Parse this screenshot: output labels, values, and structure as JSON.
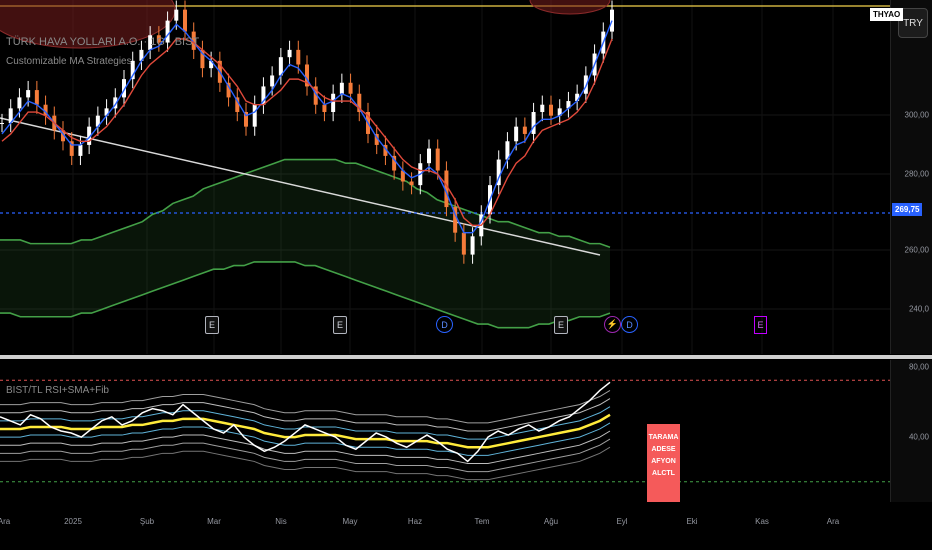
{
  "symbol_title": "TÜRK HAVA YOLLARI A.O. · 1G · BIST",
  "strategy_name": "Customizable MA Strategies",
  "indicator_name": "BIST/TL RSI+SMA+Fib",
  "symbol_tag": "THYAO",
  "currency_button": "TRY",
  "price_label": "269,75",
  "price_axis": [
    "300,00",
    "280,00",
    "260,00",
    "240,0"
  ],
  "indicator_axis": [
    "80,00",
    "40,00"
  ],
  "time_axis": [
    "Ara",
    "2025",
    "Şub",
    "Mar",
    "Nis",
    "May",
    "Haz",
    "Tem",
    "Ağu",
    "Eyl",
    "Eki",
    "Kas",
    "Ara"
  ],
  "events": [
    {
      "type": "E",
      "label": "E"
    },
    {
      "type": "E",
      "label": "E"
    },
    {
      "type": "D",
      "label": "D"
    },
    {
      "type": "E",
      "label": "E"
    },
    {
      "type": "S",
      "label": "⚡"
    },
    {
      "type": "D",
      "label": "D"
    },
    {
      "type": "P",
      "label": "E"
    }
  ],
  "scan_label": [
    "TARAMA",
    "ADESE",
    "AFYON",
    "ALCTL"
  ],
  "colors": {
    "background": "#000000",
    "up_candle": "#ffffff",
    "down_candle": "#f57c3a",
    "ma_fast": "#2962ff",
    "ma_slow": "#e0493a",
    "band": "#43a047",
    "trendline": "#d9d9d9",
    "resistance": "#f2d14b",
    "price_line": "#2962ff",
    "rsi": "#ffffff",
    "rsi_sma": "#ffeb3b",
    "scan_label": "#f55a5a"
  },
  "chart_data": {
    "type": "line",
    "title": "TÜRK HAVA YOLLARI A.O. · 1G · BIST",
    "last_price": 269.75,
    "ylim": [
      232,
      325
    ],
    "months": [
      "Ara",
      "2025",
      "Şub",
      "Mar",
      "Nis",
      "May",
      "Haz",
      "Tem",
      "Ağu",
      "Eyl",
      "Eki",
      "Kas",
      "Ara"
    ],
    "close": [
      293,
      297,
      300,
      302,
      298,
      295,
      291,
      288,
      284,
      287,
      292,
      295,
      297,
      300,
      305,
      310,
      313,
      317,
      315,
      321,
      324,
      318,
      313,
      308,
      310,
      304,
      300,
      296,
      292,
      298,
      303,
      306,
      311,
      313,
      309,
      303,
      298,
      296,
      301,
      304,
      301,
      296,
      290,
      287,
      284,
      280,
      277,
      276,
      282,
      286,
      280,
      270,
      263,
      257,
      262,
      268,
      276,
      283,
      288,
      292,
      290,
      296,
      298,
      295,
      297,
      299,
      301,
      306,
      312,
      318,
      324
    ],
    "ma_fast": [
      290,
      293,
      296,
      299,
      298,
      296,
      293,
      290,
      287,
      287,
      289,
      292,
      295,
      298,
      302,
      306,
      310,
      313,
      314,
      317,
      320,
      318,
      315,
      312,
      310,
      307,
      303,
      299,
      295,
      296,
      299,
      302,
      306,
      309,
      308,
      305,
      301,
      298,
      299,
      301,
      300,
      297,
      293,
      289,
      286,
      283,
      280,
      278,
      279,
      281,
      279,
      274,
      268,
      263,
      263,
      266,
      272,
      278,
      283,
      287,
      288,
      292,
      294,
      294,
      295,
      297,
      299,
      303,
      309,
      315,
      321
    ],
    "ma_slow": [
      288,
      290,
      293,
      296,
      296,
      295,
      293,
      291,
      289,
      288,
      288,
      290,
      292,
      295,
      298,
      302,
      306,
      309,
      311,
      313,
      316,
      316,
      315,
      313,
      311,
      309,
      306,
      303,
      299,
      298,
      298,
      300,
      302,
      305,
      305,
      304,
      302,
      300,
      299,
      299,
      299,
      297,
      295,
      292,
      289,
      286,
      283,
      281,
      280,
      280,
      279,
      276,
      272,
      267,
      265,
      265,
      268,
      273,
      278,
      282,
      284,
      288,
      291,
      292,
      293,
      294,
      296,
      299,
      304,
      310,
      316
    ],
    "band_upper": [
      261,
      261,
      261,
      260,
      260,
      260,
      260,
      260,
      261,
      261,
      262,
      263,
      264,
      265,
      266,
      268,
      269,
      271,
      272,
      273,
      275,
      276,
      277,
      278,
      279,
      280,
      281,
      282,
      283,
      283,
      283,
      283,
      283,
      283,
      282,
      282,
      281,
      280,
      279,
      278,
      277,
      275,
      274,
      272,
      271,
      270,
      269,
      268,
      267,
      266,
      266,
      265,
      264,
      263,
      263,
      262,
      262,
      261,
      260,
      260,
      259
    ],
    "band_lower": [
      241,
      241,
      240,
      240,
      240,
      240,
      240,
      240,
      241,
      241,
      242,
      243,
      244,
      245,
      246,
      247,
      248,
      249,
      250,
      251,
      252,
      253,
      253,
      254,
      254,
      255,
      255,
      255,
      255,
      255,
      254,
      254,
      253,
      252,
      251,
      250,
      249,
      248,
      247,
      246,
      245,
      244,
      243,
      242,
      241,
      240,
      239,
      238,
      238,
      237,
      237,
      237,
      237,
      238,
      238,
      239,
      239,
      240,
      240,
      240,
      241
    ],
    "rsi": [
      62,
      60,
      58,
      63,
      61,
      57,
      55,
      54,
      52,
      56,
      60,
      62,
      58,
      60,
      64,
      66,
      65,
      63,
      68,
      64,
      60,
      56,
      54,
      58,
      52,
      48,
      45,
      47,
      50,
      54,
      58,
      56,
      54,
      52,
      48,
      46,
      50,
      54,
      52,
      49,
      47,
      50,
      53,
      50,
      46,
      44,
      40,
      45,
      52,
      55,
      53,
      56,
      58,
      55,
      57,
      60,
      62,
      66,
      70,
      75,
      79
    ],
    "rsi_sma": [
      56,
      56,
      56,
      57,
      57,
      57,
      57,
      56,
      56,
      56,
      57,
      57,
      57,
      58,
      58,
      59,
      60,
      60,
      61,
      61,
      61,
      60,
      59,
      58,
      57,
      56,
      54,
      53,
      52,
      52,
      53,
      53,
      53,
      53,
      52,
      51,
      51,
      51,
      51,
      50,
      50,
      50,
      50,
      49,
      49,
      48,
      47,
      47,
      47,
      48,
      49,
      50,
      51,
      52,
      53,
      54,
      55,
      56,
      58,
      60,
      63
    ],
    "rsi_ylim": [
      20,
      90
    ],
    "rsi_levels": [
      80,
      40
    ]
  }
}
